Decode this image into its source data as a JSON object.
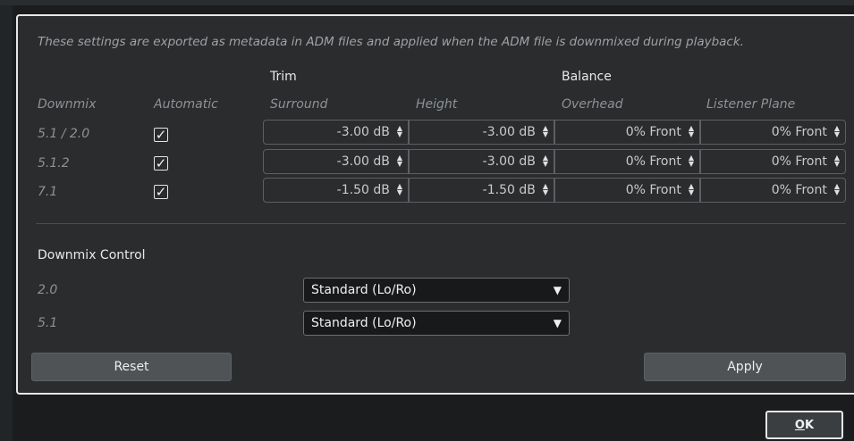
{
  "description": "These settings are exported as metadata in ADM files and applied when the ADM file is downmixed during playback.",
  "groups": {
    "trim": "Trim",
    "balance": "Balance"
  },
  "columns": {
    "downmix": "Downmix",
    "automatic": "Automatic",
    "surround": "Surround",
    "height": "Height",
    "overhead": "Overhead",
    "listener_plane": "Listener Plane"
  },
  "rows": [
    {
      "label": "5.1 / 2.0",
      "automatic": "✓",
      "surround": "-3.00 dB",
      "height": "-3.00 dB",
      "overhead": "0% Front",
      "listener_plane": "0% Front"
    },
    {
      "label": "5.1.2",
      "automatic": "✓",
      "surround": "-3.00 dB",
      "height": "-3.00 dB",
      "overhead": "0% Front",
      "listener_plane": "0% Front"
    },
    {
      "label": "7.1",
      "automatic": "✓",
      "surround": "-1.50 dB",
      "height": "-1.50 dB",
      "overhead": "0% Front",
      "listener_plane": "0% Front"
    }
  ],
  "downmix_control": {
    "title": "Downmix Control",
    "items": [
      {
        "label": "2.0",
        "value": "Standard (Lo/Ro)"
      },
      {
        "label": "5.1",
        "value": "Standard (Lo/Ro)"
      }
    ]
  },
  "buttons": {
    "reset": "Reset",
    "apply": "Apply",
    "ok_underlined": "O",
    "ok_rest": "K"
  },
  "icons": {
    "spin_up": "▲",
    "spin_down": "▼",
    "dropdown": "▼"
  }
}
